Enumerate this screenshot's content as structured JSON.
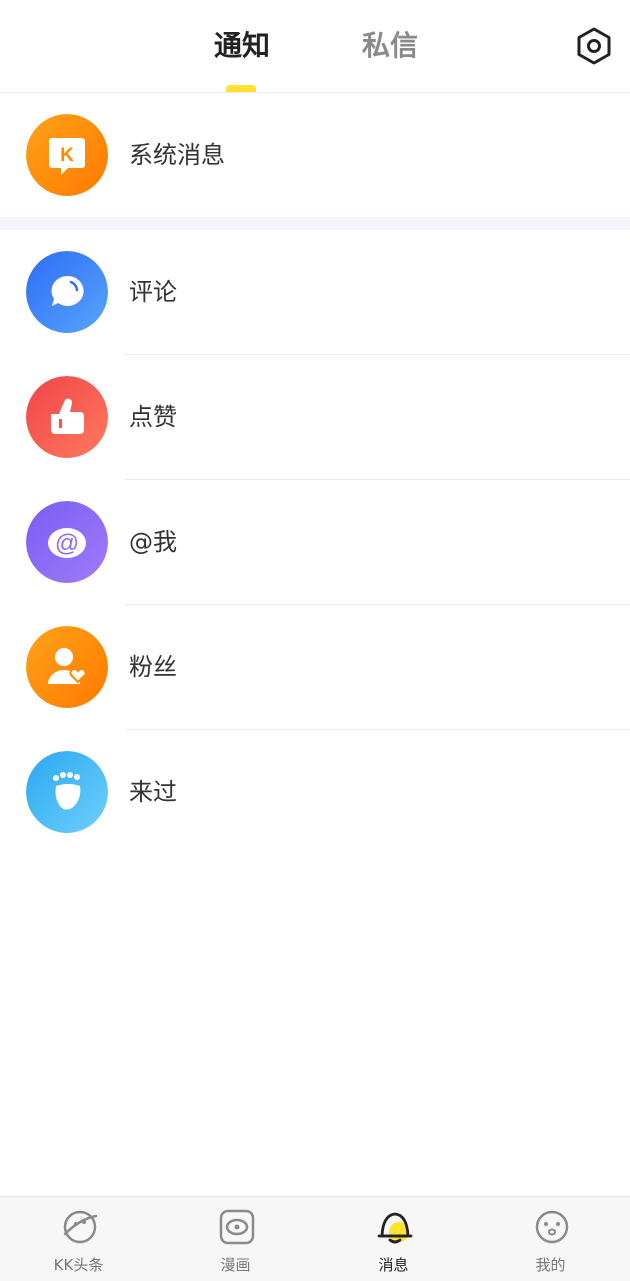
{
  "header": {
    "tabs": [
      {
        "label": "通知",
        "active": true
      },
      {
        "label": "私信",
        "active": false
      }
    ],
    "settings_icon": "settings-icon",
    "indicator_color": "#ffe22d"
  },
  "items": [
    {
      "label": "系统消息",
      "icon": "kuaikan-k-icon",
      "color": "#ff8a00"
    },
    {
      "label": "评论",
      "icon": "comment-bubble-icon",
      "color": "#3b82f6"
    },
    {
      "label": "点赞",
      "icon": "thumbs-up-icon",
      "color": "#f0544a"
    },
    {
      "label": "@我",
      "icon": "at-sign-icon",
      "color": "#8b6cf6"
    },
    {
      "label": "粉丝",
      "icon": "fan-user-heart-icon",
      "color": "#ff8a00"
    },
    {
      "label": "来过",
      "icon": "footprint-icon",
      "color": "#38b6f1"
    }
  ],
  "bottom_nav": [
    {
      "label": "KK头条",
      "icon": "planet-face-icon",
      "active": false
    },
    {
      "label": "漫画",
      "icon": "eye-frame-icon",
      "active": false
    },
    {
      "label": "消息",
      "icon": "bell-icon",
      "active": true
    },
    {
      "label": "我的",
      "icon": "face-icon",
      "active": false
    }
  ]
}
